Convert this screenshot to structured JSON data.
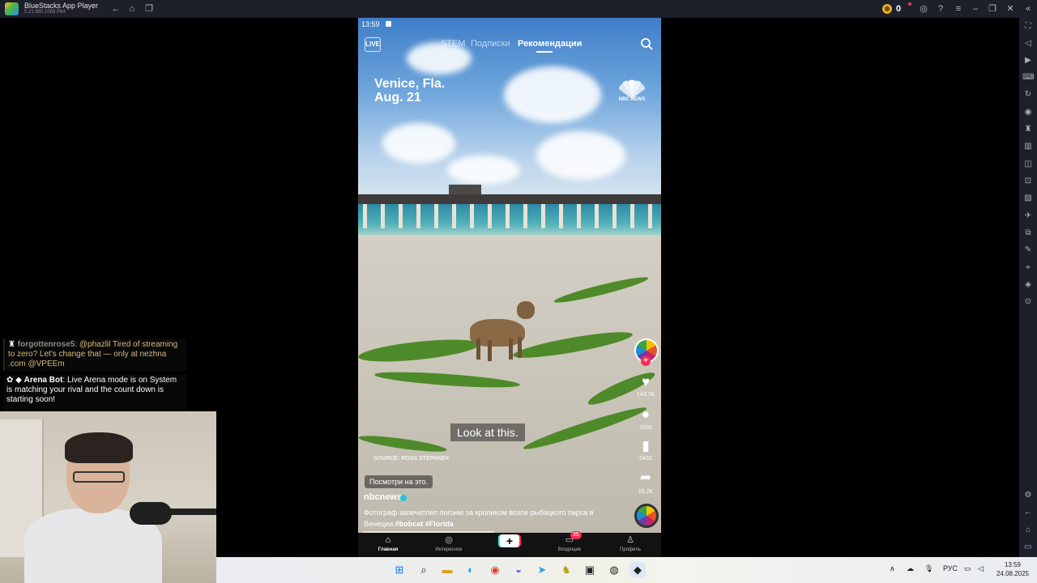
{
  "window": {
    "title": "BlueStacks App Player",
    "version": "5.21.650.1003 P64",
    "coins": "0"
  },
  "phone": {
    "status_time": "13:59",
    "feed_tabs": [
      "STEM",
      "Подписки",
      "Рекомендации"
    ],
    "live_label": "LIVE",
    "location_line1": "Venice, Fla.",
    "location_line2": "Aug. 21",
    "watermark": "NBC NEWS",
    "subtitle": "Look at this.",
    "source": "SOURCE: ROSS STEPANEK",
    "look_chip": "Посмотри на это.",
    "username": "nbcnews",
    "description_line1": "Фотограф запечатлел погоню за кроликом возле рыбацкого пирса в",
    "description_line2_prefix": "Венеции.",
    "hashtags": "#bobcat #Florida",
    "actions": {
      "likes": "143.7K",
      "comments": "1530",
      "saves": "5432",
      "shares": "15.2K"
    },
    "nav": {
      "home": "Главная",
      "explore": "Интересное",
      "inbox": "Входящие",
      "inbox_badge": "35",
      "profile": "Профиль"
    }
  },
  "chat": {
    "msg1_user": "forgottenrose5",
    "msg1_text": ": @phazlil Tired of streaming to zero? Let's change that — only at nezhna .com @VPEEm",
    "msg2_user": "Arena Bot",
    "msg2_text": ": Live Arena mode is on System is matching your rival and the count down is starting soon!"
  },
  "taskbar": {
    "language": "РУС",
    "time": "13:59",
    "date": "24.08.2025"
  },
  "colors": {
    "titlebar": "#1d1f2b",
    "tiktok_red": "#fe2c55",
    "tiktok_cyan": "#25f4ee"
  }
}
